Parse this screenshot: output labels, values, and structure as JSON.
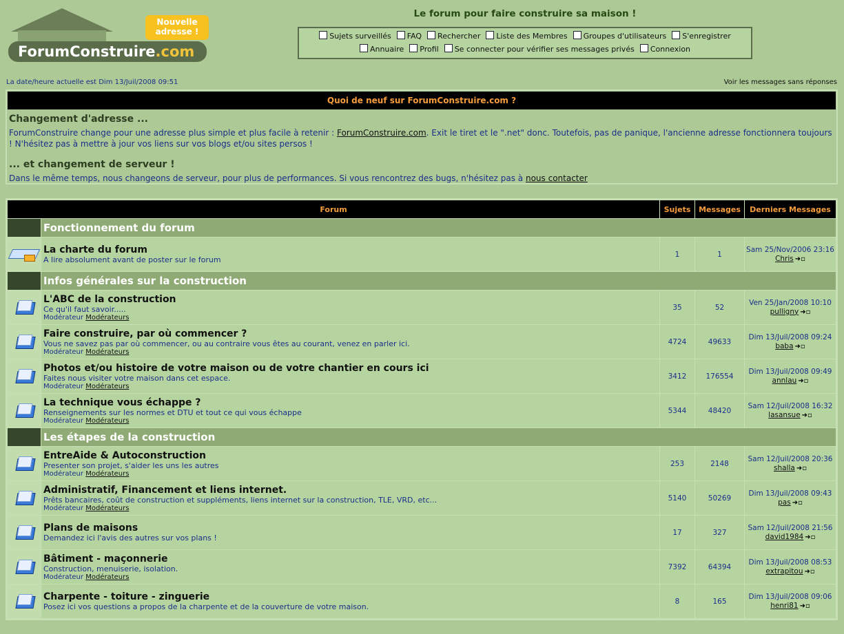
{
  "header": {
    "logo_main": "ForumConstruire",
    "logo_suffix": ".com",
    "badge_line1": "Nouvelle",
    "badge_line2": "adresse !",
    "slogan": "Le forum pour faire construire sa maison !"
  },
  "nav": {
    "row1": [
      {
        "label": "Sujets surveillés",
        "icon": "watch-icon"
      },
      {
        "label": "FAQ",
        "icon": "faq-icon"
      },
      {
        "label": "Rechercher",
        "icon": "search-icon"
      },
      {
        "label": "Liste des Membres",
        "icon": "members-icon"
      },
      {
        "label": "Groupes d'utilisateurs",
        "icon": "groups-icon"
      },
      {
        "label": "S'enregistrer",
        "icon": "register-icon"
      }
    ],
    "row2": [
      {
        "label": "Annuaire",
        "icon": "directory-icon"
      },
      {
        "label": "Profil",
        "icon": "profile-icon"
      },
      {
        "label": "Se connecter pour vérifier ses messages privés",
        "icon": "pm-icon"
      },
      {
        "label": "Connexion",
        "icon": "login-icon"
      }
    ]
  },
  "datebar": "La date/heure actuelle est Dim 13/Juil/2008 09:51",
  "unanswered": "Voir les messages sans réponses",
  "news": {
    "header": "Quoi de neuf sur ForumConstruire.com ?",
    "h1": "Changement d'adresse ...",
    "p1_pre": "ForumConstruire change pour une adresse plus simple et plus facile à retenir : ",
    "p1_link": "ForumConstruire.com",
    "p1_post": ". Exit le tiret et le \".net\" donc. Toutefois, pas de panique, l'ancienne adresse fonctionnera toujours ! N'hésitez pas à mettre à jour vos liens sur vos blogs et/ou sites persos !",
    "h2": "... et changement de serveur !",
    "p2_pre": "Dans le même temps, nous changeons de serveur, pour plus de performances. Si vous rencontrez des bugs, n'hésitez pas à ",
    "p2_link": "nous contacter"
  },
  "table": {
    "col_forum": "Forum",
    "col_topics": "Sujets",
    "col_posts": "Messages",
    "col_last": "Derniers Messages",
    "mod_label": "Modérateur",
    "mod_link": "Modérateurs"
  },
  "categories": [
    {
      "name": "Fonctionnement du forum",
      "forums": [
        {
          "title": "La charte du forum",
          "desc": "A lire absolument avant de poster sur le forum",
          "topics": "1",
          "posts": "1",
          "last_date": "Sam 25/Nov/2006 23:16",
          "last_user": "Chris",
          "mod": false,
          "icon": "book"
        }
      ]
    },
    {
      "name": "Infos générales sur la construction",
      "forums": [
        {
          "title": "L'ABC de la construction",
          "desc": "Ce qu'il faut savoir.....",
          "topics": "35",
          "posts": "52",
          "last_date": "Ven 25/Jan/2008 10:10",
          "last_user": "pulligny",
          "mod": true
        },
        {
          "title": "Faire construire, par où commencer ?",
          "desc": "Vous ne savez pas par où commencer, ou au contraire vous êtes au courant, venez en parler ici.",
          "topics": "4724",
          "posts": "49633",
          "last_date": "Dim 13/Juil/2008 09:24",
          "last_user": "baba",
          "mod": true
        },
        {
          "title": "Photos et/ou histoire de votre maison ou de votre chantier en cours ici",
          "desc": "Faites nous visiter votre maison dans cet espace.",
          "topics": "3412",
          "posts": "176554",
          "last_date": "Dim 13/Juil/2008 09:49",
          "last_user": "annlau",
          "mod": true
        },
        {
          "title": "La technique vous échappe ?",
          "desc": "Renseignements sur les normes et DTU et tout ce qui vous échappe",
          "topics": "5344",
          "posts": "48420",
          "last_date": "Sam 12/Juil/2008 16:32",
          "last_user": "lasansue",
          "mod": true
        }
      ]
    },
    {
      "name": "Les étapes de la construction",
      "forums": [
        {
          "title": "EntreAide & Autoconstruction",
          "desc": "Presenter son projet, s'aider les uns les autres",
          "topics": "253",
          "posts": "2148",
          "last_date": "Sam 12/Juil/2008 20:36",
          "last_user": "shalla",
          "mod": true
        },
        {
          "title": "Administratif, Financement et liens internet.",
          "desc": "Prêts bancaires, coût de construction et suppléments, liens internet sur la construction, TLE, VRD, etc...",
          "topics": "5140",
          "posts": "50269",
          "last_date": "Dim 13/Juil/2008 09:43",
          "last_user": "pas",
          "mod": true
        },
        {
          "title": "Plans de maisons",
          "desc": "Demandez ici l'avis des autres sur vos plans !",
          "topics": "17",
          "posts": "327",
          "last_date": "Sam 12/Juil/2008 21:56",
          "last_user": "david1984",
          "mod": false
        },
        {
          "title": "Bâtiment - maçonnerie",
          "desc": "Construction, menuiserie, isolation.",
          "topics": "7392",
          "posts": "64394",
          "last_date": "Dim 13/Juil/2008 08:53",
          "last_user": "extrapitou",
          "mod": true
        },
        {
          "title": "Charpente - toiture - zinguerie",
          "desc": "Posez ici vos questions a propos de la charpente et de la couverture de votre maison.",
          "topics": "8",
          "posts": "165",
          "last_date": "Dim 13/Juil/2008 09:06",
          "last_user": "henri81",
          "mod": false
        }
      ]
    }
  ]
}
